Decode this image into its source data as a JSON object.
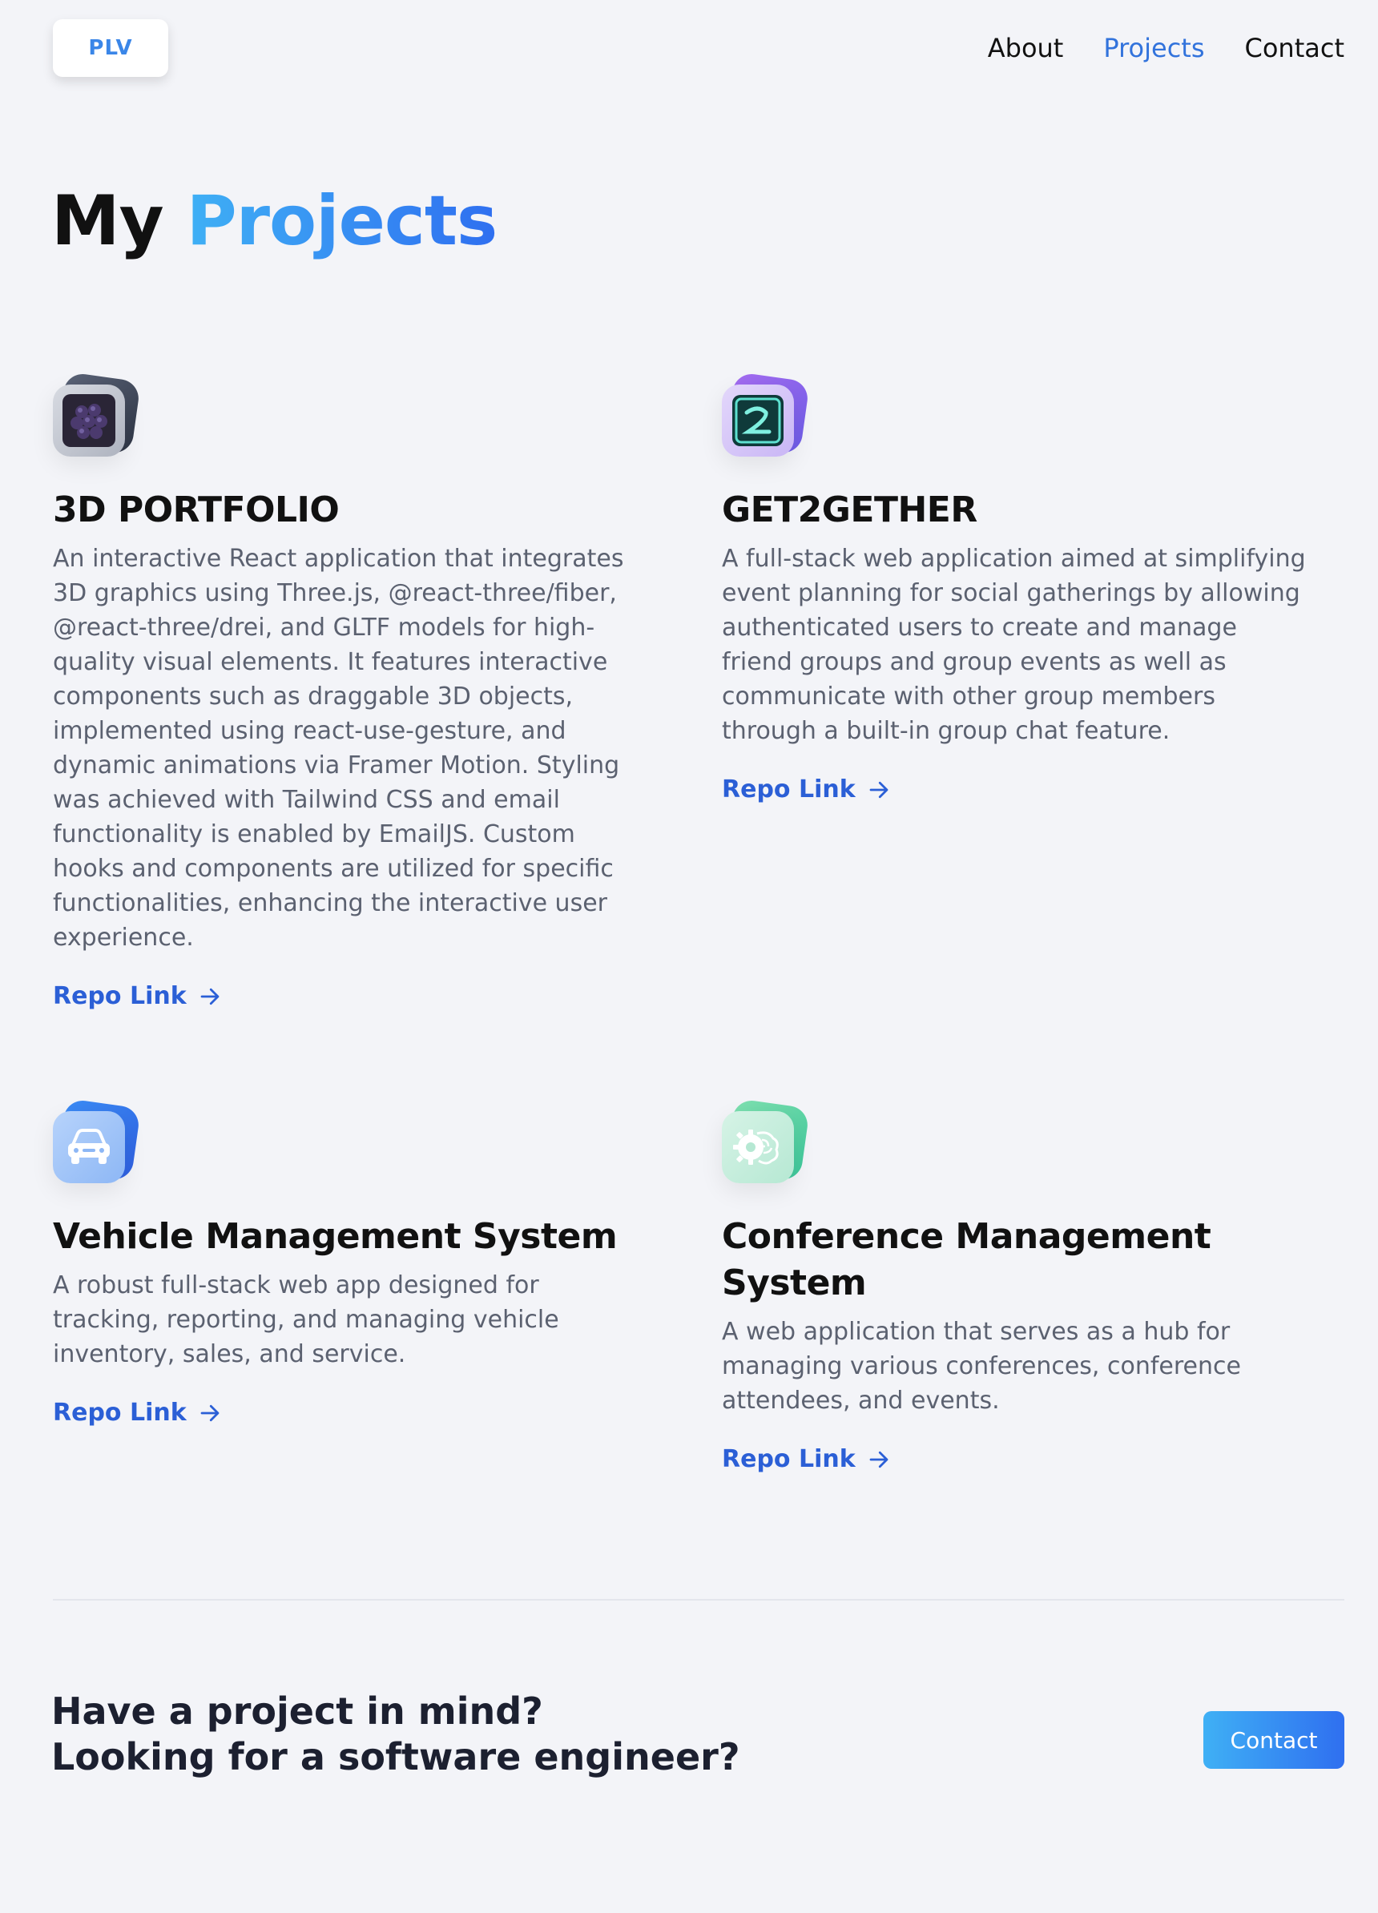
{
  "header": {
    "logo": "PLV",
    "nav": [
      "About",
      "Projects",
      "Contact"
    ],
    "active_nav": "Projects"
  },
  "title": {
    "part1": "My",
    "part2": "Projects"
  },
  "projects": [
    {
      "name": "3D PORTFOLIO",
      "icon": "blackberry-3d-icon",
      "description": "An interactive React application that integrates 3D graphics using Three.js, @react-three/fiber, @react-three/drei, and GLTF models for high-quality visual elements. It features interactive components such as draggable 3D objects, implemented using react-use-gesture, and dynamic animations via Framer Motion. Styling was achieved with Tailwind CSS and email functionality is enabled by EmailJS. Custom hooks and components are utilized for specific functionalities, enhancing the interactive user experience.",
      "link": "Repo Link"
    },
    {
      "name": "GET2GETHER",
      "icon": "g2-logo-icon",
      "description": "A full-stack web application aimed at simplifying event planning for social gatherings by allowing authenticated users to create and manage friend groups and group events as well as communicate with other group members through a built-in group chat feature.",
      "link": "Repo Link"
    },
    {
      "name": "Vehicle Management System",
      "icon": "car-icon",
      "description": "A robust full-stack web app designed for tracking, reporting, and managing vehicle inventory, sales, and service.",
      "link": "Repo Link"
    },
    {
      "name": "Conference Management System",
      "icon": "brain-gear-icon",
      "description": "A web application that serves as a hub for managing various conferences, conference attendees, and events.",
      "link": "Repo Link"
    }
  ],
  "cta": {
    "line1": "Have a project in mind?",
    "line2": "Looking for a software engineer?",
    "button": "Contact"
  },
  "colors": {
    "accent": "#3273dc",
    "link": "#2b5fd6",
    "background": "#f3f4f8"
  }
}
